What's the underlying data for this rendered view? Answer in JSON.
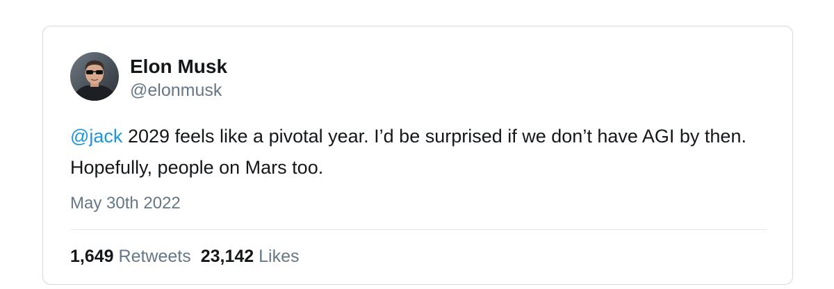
{
  "tweet": {
    "author": {
      "name": "Elon Musk",
      "handle": "@elonmusk"
    },
    "text": {
      "mention": "@jack",
      "body": " 2029 feels like a pivotal year. I’d be surprised if we don’t have AGI by then. Hopefully, people on Mars too."
    },
    "date": "May 30th 2022",
    "stats": {
      "retweets_count": "1,649",
      "retweets_label": "Retweets",
      "likes_count": "23,142",
      "likes_label": "Likes"
    }
  },
  "colors": {
    "mention": "#1b95e0",
    "secondary_text": "#657786",
    "primary_text": "#14171a",
    "border": "#cfd9de"
  }
}
